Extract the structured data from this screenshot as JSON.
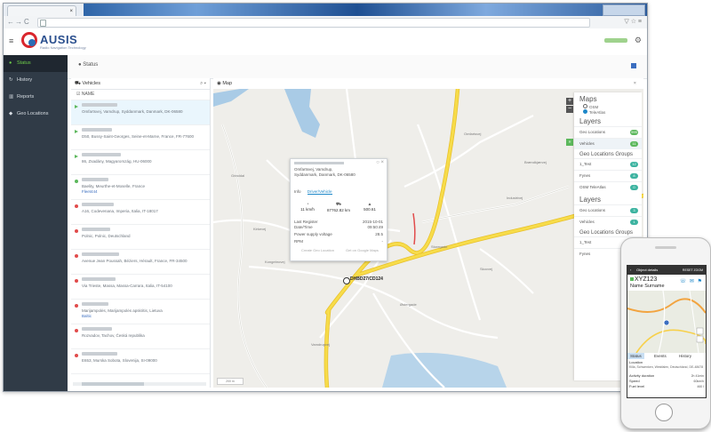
{
  "browser": {
    "tab_title": "",
    "window_controls": "",
    "url": ""
  },
  "header": {
    "logo_text": "AUSIS",
    "logo_sub": "Radio Navigation Technology"
  },
  "sidebar": {
    "items": [
      {
        "icon": "●",
        "label": "Status"
      },
      {
        "icon": "↻",
        "label": "History"
      },
      {
        "icon": "▥",
        "label": "Reports"
      },
      {
        "icon": "◆",
        "label": "Geo Locations"
      }
    ]
  },
  "status_bar": {
    "label": "Status"
  },
  "vehicles": {
    "title": "Vehicles",
    "column": "NAME",
    "rows": [
      {
        "status": "moving",
        "color": "#5cb85c",
        "address": "Omfartsvej, Vamdrup, Syddanmark, Danmark, DK-06580",
        "tag": ""
      },
      {
        "status": "moving",
        "color": "#5cb85c",
        "address": "D50, Bussy-Saint-Georges, Seine-et-Marne, France, FR-77600",
        "tag": ""
      },
      {
        "status": "moving",
        "color": "#5cb85c",
        "address": "86, Zsadány, Magyarország, HU-06000",
        "tag": ""
      },
      {
        "status": "idle",
        "color": "#5cb85c",
        "address": "Baelity, Meurthe-et-Moselle, France",
        "tag": "Fleet444"
      },
      {
        "status": "stopped",
        "color": "#e14b4b",
        "address": "A16, Codevenana, Imperia, Italia, IT-18017",
        "tag": ""
      },
      {
        "status": "stopped",
        "color": "#e14b4b",
        "address": "Polnic, Polnic, Deutschland",
        "tag": ""
      },
      {
        "status": "stopped",
        "color": "#e14b4b",
        "address": "Avenue Jean Poussah, Béziers, Hérault, France, FR-34500",
        "tag": ""
      },
      {
        "status": "stopped",
        "color": "#e14b4b",
        "address": "Via Trieste, Massa, Massa-Carrara, Italia, IT-54100",
        "tag": ""
      },
      {
        "status": "stopped",
        "color": "#e14b4b",
        "address": "Marijampolės, Marijampolės apskritis, Lietuva",
        "tag": "Baltic"
      },
      {
        "status": "stopped",
        "color": "#e14b4b",
        "address": "Rozvadov, Tachov, Česká republika",
        "tag": ""
      },
      {
        "status": "stopped",
        "color": "#e14b4b",
        "address": "E653, Murska Sobota, Slovenija, SI-09000",
        "tag": ""
      }
    ]
  },
  "map": {
    "title": "Map",
    "marker_label": "DHBD27/CD124",
    "attribution": "200 m",
    "labels": [
      {
        "text": "Grinddal"
      },
      {
        "text": "Kongebrovej"
      },
      {
        "text": "Omfartsvej"
      },
      {
        "text": "Industrivej"
      },
      {
        "text": "Østergade"
      },
      {
        "text": "Vamdrupvej"
      },
      {
        "text": "Storegade"
      },
      {
        "text": "Kirkevej"
      },
      {
        "text": "Skovvej"
      },
      {
        "text": "Brændkjærvej"
      },
      {
        "text": "Stationsvej"
      }
    ],
    "popup": {
      "address": "Omfartsvej, Vamdrup, Syddanmark, Danmark, DK-06580",
      "tabs": [
        "Info",
        "Driver/Vehicle"
      ],
      "stats": [
        {
          "icon": "◔",
          "value": "11 km/h"
        },
        {
          "icon": "⛟",
          "value": "87762.82 km"
        },
        {
          "icon": "▲",
          "value": "500.61"
        }
      ],
      "rows": [
        {
          "label": "Last Register",
          "value": "2015-10-01"
        },
        {
          "label": "Date/Time",
          "value": "09:50:49"
        },
        {
          "label": "Power supply voltage",
          "value": "28.5"
        },
        {
          "label": "RPM",
          "value": "-"
        }
      ],
      "buttons": [
        "Create Geo Location",
        "Get on Google Maps"
      ]
    },
    "layers_panel": {
      "maps_title": "Maps",
      "map_options": [
        {
          "label": "OSM",
          "selected": false
        },
        {
          "label": "TeleAtlas",
          "selected": true
        }
      ],
      "layers_title": "Layers",
      "layers": [
        {
          "label": "Geo Locations",
          "count": "999"
        },
        {
          "label": "Vehicles",
          "count": "11"
        }
      ],
      "groups_title": "Geo Locations Groups",
      "groups": [
        {
          "label": "1_Test",
          "count": "12"
        },
        {
          "label": "Fynes",
          "count": "8"
        },
        {
          "label": "OSM TeleAtlas",
          "count": "0"
        }
      ],
      "layers_title_2": "Layers",
      "layers_2": [
        {
          "label": "Geo Locations",
          "count": "3"
        },
        {
          "label": "Vehicles",
          "count": "1"
        }
      ],
      "groups_title_2": "Geo Locations Groups",
      "groups_2": [
        {
          "label": "1_Test",
          "count": "2"
        },
        {
          "label": "Fynes",
          "count": "1"
        }
      ]
    }
  },
  "phone": {
    "title": "Object details",
    "right_action": "RESET ZOOM",
    "object_name": "XYZ123",
    "owner": "Name Surname",
    "tabs": [
      "Status",
      "Events",
      "History"
    ],
    "info": [
      {
        "label": "Location",
        "value": ""
      },
      {
        "label": "Killa, Schwenken, Westfalen, Deutschland, DE-48678",
        "value": ""
      },
      {
        "label": "Activity duration",
        "value": "2h 41min"
      },
      {
        "label": "Speed",
        "value": "60km/h"
      },
      {
        "label": "Fuel level",
        "value": "460 l"
      }
    ]
  },
  "colors": {
    "sidebar": "#303b47",
    "accent_green": "#5cb85c",
    "stopped_red": "#e14b4b",
    "road_yellow": "#f5d535",
    "water": "#a9cbe6"
  }
}
